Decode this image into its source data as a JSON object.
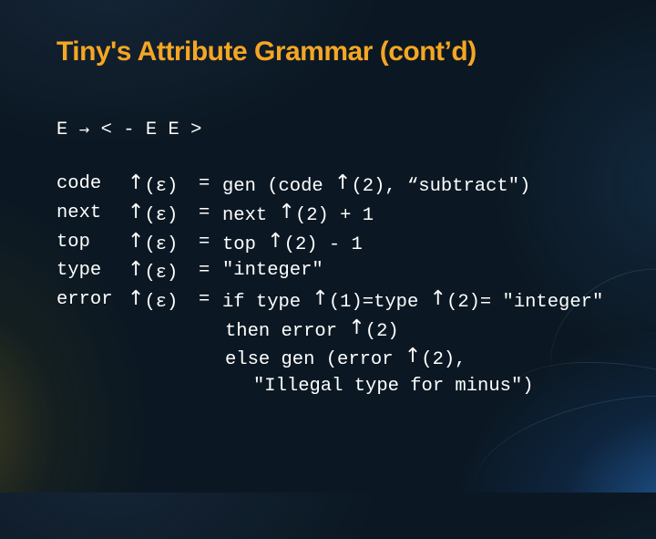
{
  "slide": {
    "title": "Tiny's Attribute Grammar (cont’d)",
    "production": {
      "lhs": "E",
      "arrow": "→",
      "rhs": "< - E E >"
    },
    "rules": [
      {
        "attr": "code",
        "arg": "(ε)",
        "eq": "=",
        "rhs_pre": "gen (code ",
        "rhs_post": "(2), “subtract\")"
      },
      {
        "attr": "next",
        "arg": "(ε)",
        "eq": "=",
        "rhs_pre": "next ",
        "rhs_post": "(2) + 1"
      },
      {
        "attr": "top",
        "arg": "(ε)",
        "eq": "=",
        "rhs_pre": "top ",
        "rhs_post": "(2) - 1"
      },
      {
        "attr": "type",
        "arg": "(ε)",
        "eq": "=",
        "rhs_pre": "\"integer\"",
        "rhs_post": ""
      },
      {
        "attr": "error",
        "arg": "(ε)",
        "eq": "=",
        "rhs_pre": "if type ",
        "rhs_mid": "(1)=type ",
        "rhs_post": "(2)= \"integer\""
      }
    ],
    "continuation": [
      {
        "pre": "then error ",
        "post": "(2)"
      },
      {
        "pre": "else gen (error ",
        "post": "(2),"
      },
      {
        "pre": "\"Illegal type for minus\")",
        "post": ""
      }
    ],
    "up_arrow_symbol": "↑",
    "colors": {
      "title": "#f5a623",
      "text": "#ffffff",
      "background": "#0b1823"
    }
  }
}
